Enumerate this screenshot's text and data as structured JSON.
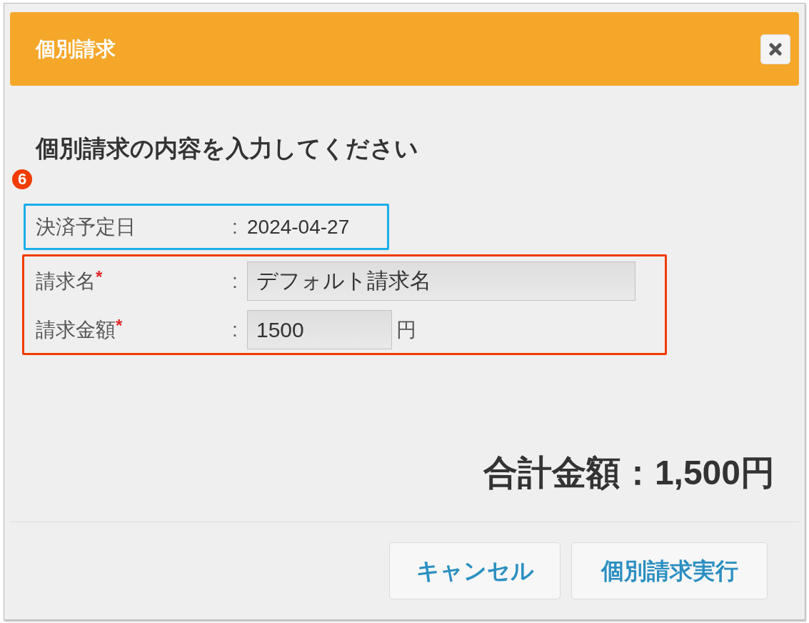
{
  "dialog": {
    "title": "個別請求",
    "heading": "個別請求の内容を入力してください",
    "step_badge": "6",
    "groups": [
      {
        "color": "#1aaeea",
        "fields": [
          {
            "kind": "static",
            "label": "決済予定日",
            "separator": ":",
            "value": "2024-04-27"
          }
        ]
      },
      {
        "color": "#f03c00",
        "fields": [
          {
            "kind": "text",
            "label": "請求名",
            "required_mark": "*",
            "separator": ":",
            "value": "デフォルト請求名"
          },
          {
            "kind": "number",
            "label": "請求金額",
            "required_mark": "*",
            "separator": ":",
            "value": "1500",
            "unit": "円"
          }
        ]
      }
    ],
    "total": "合計金額：1,500円",
    "buttons": [
      {
        "label": "キャンセル"
      },
      {
        "label": "個別請求実行"
      }
    ]
  }
}
